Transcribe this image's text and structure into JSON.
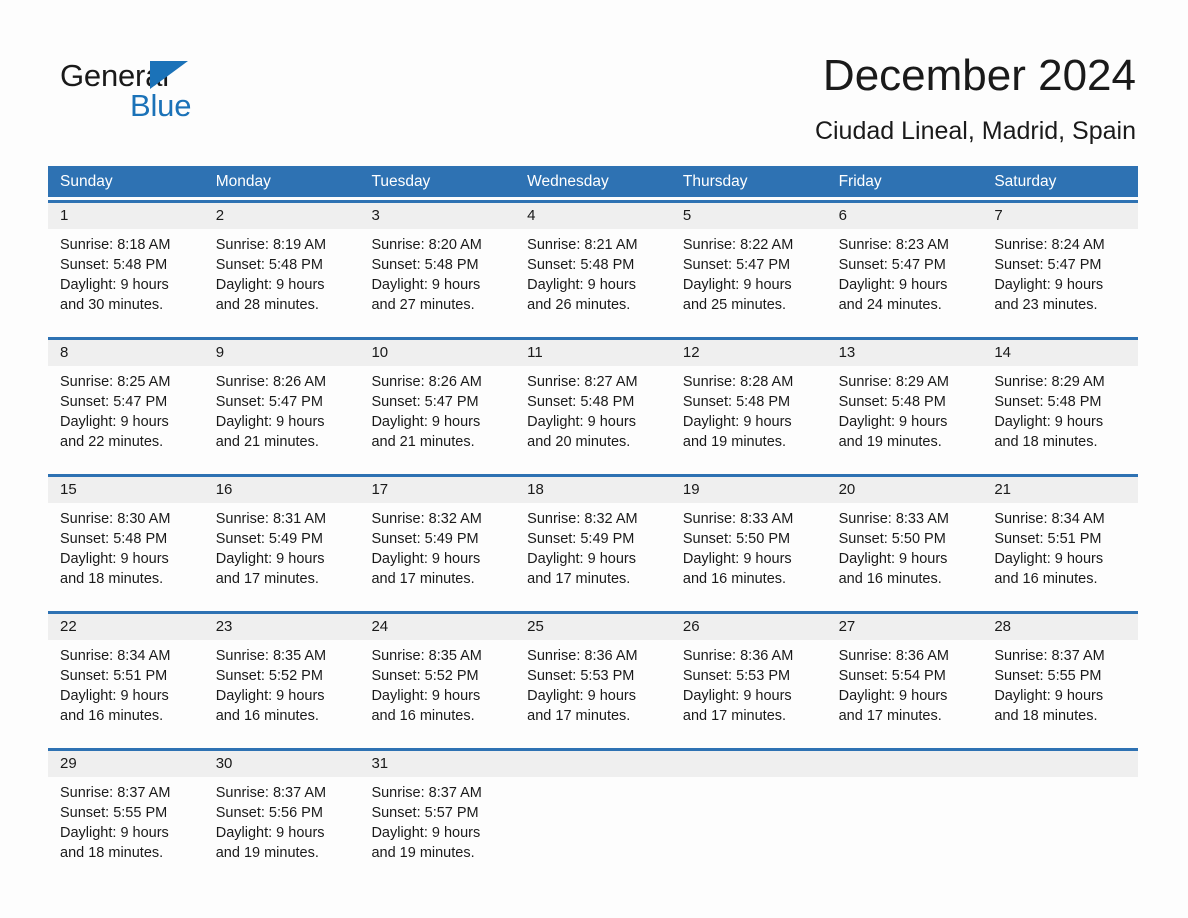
{
  "brand": {
    "name_part1": "General",
    "name_part2": "Blue",
    "accent_color": "#1b72b8"
  },
  "header": {
    "month_title": "December 2024",
    "location": "Ciudad Lineal, Madrid, Spain"
  },
  "calendar": {
    "header_color": "#2e72b3",
    "weekdays": [
      "Sunday",
      "Monday",
      "Tuesday",
      "Wednesday",
      "Thursday",
      "Friday",
      "Saturday"
    ],
    "weeks": [
      [
        {
          "date": "1",
          "sunrise": "Sunrise: 8:18 AM",
          "sunset": "Sunset: 5:48 PM",
          "daylight_line1": "Daylight: 9 hours",
          "daylight_line2": "and 30 minutes."
        },
        {
          "date": "2",
          "sunrise": "Sunrise: 8:19 AM",
          "sunset": "Sunset: 5:48 PM",
          "daylight_line1": "Daylight: 9 hours",
          "daylight_line2": "and 28 minutes."
        },
        {
          "date": "3",
          "sunrise": "Sunrise: 8:20 AM",
          "sunset": "Sunset: 5:48 PM",
          "daylight_line1": "Daylight: 9 hours",
          "daylight_line2": "and 27 minutes."
        },
        {
          "date": "4",
          "sunrise": "Sunrise: 8:21 AM",
          "sunset": "Sunset: 5:48 PM",
          "daylight_line1": "Daylight: 9 hours",
          "daylight_line2": "and 26 minutes."
        },
        {
          "date": "5",
          "sunrise": "Sunrise: 8:22 AM",
          "sunset": "Sunset: 5:47 PM",
          "daylight_line1": "Daylight: 9 hours",
          "daylight_line2": "and 25 minutes."
        },
        {
          "date": "6",
          "sunrise": "Sunrise: 8:23 AM",
          "sunset": "Sunset: 5:47 PM",
          "daylight_line1": "Daylight: 9 hours",
          "daylight_line2": "and 24 minutes."
        },
        {
          "date": "7",
          "sunrise": "Sunrise: 8:24 AM",
          "sunset": "Sunset: 5:47 PM",
          "daylight_line1": "Daylight: 9 hours",
          "daylight_line2": "and 23 minutes."
        }
      ],
      [
        {
          "date": "8",
          "sunrise": "Sunrise: 8:25 AM",
          "sunset": "Sunset: 5:47 PM",
          "daylight_line1": "Daylight: 9 hours",
          "daylight_line2": "and 22 minutes."
        },
        {
          "date": "9",
          "sunrise": "Sunrise: 8:26 AM",
          "sunset": "Sunset: 5:47 PM",
          "daylight_line1": "Daylight: 9 hours",
          "daylight_line2": "and 21 minutes."
        },
        {
          "date": "10",
          "sunrise": "Sunrise: 8:26 AM",
          "sunset": "Sunset: 5:47 PM",
          "daylight_line1": "Daylight: 9 hours",
          "daylight_line2": "and 21 minutes."
        },
        {
          "date": "11",
          "sunrise": "Sunrise: 8:27 AM",
          "sunset": "Sunset: 5:48 PM",
          "daylight_line1": "Daylight: 9 hours",
          "daylight_line2": "and 20 minutes."
        },
        {
          "date": "12",
          "sunrise": "Sunrise: 8:28 AM",
          "sunset": "Sunset: 5:48 PM",
          "daylight_line1": "Daylight: 9 hours",
          "daylight_line2": "and 19 minutes."
        },
        {
          "date": "13",
          "sunrise": "Sunrise: 8:29 AM",
          "sunset": "Sunset: 5:48 PM",
          "daylight_line1": "Daylight: 9 hours",
          "daylight_line2": "and 19 minutes."
        },
        {
          "date": "14",
          "sunrise": "Sunrise: 8:29 AM",
          "sunset": "Sunset: 5:48 PM",
          "daylight_line1": "Daylight: 9 hours",
          "daylight_line2": "and 18 minutes."
        }
      ],
      [
        {
          "date": "15",
          "sunrise": "Sunrise: 8:30 AM",
          "sunset": "Sunset: 5:48 PM",
          "daylight_line1": "Daylight: 9 hours",
          "daylight_line2": "and 18 minutes."
        },
        {
          "date": "16",
          "sunrise": "Sunrise: 8:31 AM",
          "sunset": "Sunset: 5:49 PM",
          "daylight_line1": "Daylight: 9 hours",
          "daylight_line2": "and 17 minutes."
        },
        {
          "date": "17",
          "sunrise": "Sunrise: 8:32 AM",
          "sunset": "Sunset: 5:49 PM",
          "daylight_line1": "Daylight: 9 hours",
          "daylight_line2": "and 17 minutes."
        },
        {
          "date": "18",
          "sunrise": "Sunrise: 8:32 AM",
          "sunset": "Sunset: 5:49 PM",
          "daylight_line1": "Daylight: 9 hours",
          "daylight_line2": "and 17 minutes."
        },
        {
          "date": "19",
          "sunrise": "Sunrise: 8:33 AM",
          "sunset": "Sunset: 5:50 PM",
          "daylight_line1": "Daylight: 9 hours",
          "daylight_line2": "and 16 minutes."
        },
        {
          "date": "20",
          "sunrise": "Sunrise: 8:33 AM",
          "sunset": "Sunset: 5:50 PM",
          "daylight_line1": "Daylight: 9 hours",
          "daylight_line2": "and 16 minutes."
        },
        {
          "date": "21",
          "sunrise": "Sunrise: 8:34 AM",
          "sunset": "Sunset: 5:51 PM",
          "daylight_line1": "Daylight: 9 hours",
          "daylight_line2": "and 16 minutes."
        }
      ],
      [
        {
          "date": "22",
          "sunrise": "Sunrise: 8:34 AM",
          "sunset": "Sunset: 5:51 PM",
          "daylight_line1": "Daylight: 9 hours",
          "daylight_line2": "and 16 minutes."
        },
        {
          "date": "23",
          "sunrise": "Sunrise: 8:35 AM",
          "sunset": "Sunset: 5:52 PM",
          "daylight_line1": "Daylight: 9 hours",
          "daylight_line2": "and 16 minutes."
        },
        {
          "date": "24",
          "sunrise": "Sunrise: 8:35 AM",
          "sunset": "Sunset: 5:52 PM",
          "daylight_line1": "Daylight: 9 hours",
          "daylight_line2": "and 16 minutes."
        },
        {
          "date": "25",
          "sunrise": "Sunrise: 8:36 AM",
          "sunset": "Sunset: 5:53 PM",
          "daylight_line1": "Daylight: 9 hours",
          "daylight_line2": "and 17 minutes."
        },
        {
          "date": "26",
          "sunrise": "Sunrise: 8:36 AM",
          "sunset": "Sunset: 5:53 PM",
          "daylight_line1": "Daylight: 9 hours",
          "daylight_line2": "and 17 minutes."
        },
        {
          "date": "27",
          "sunrise": "Sunrise: 8:36 AM",
          "sunset": "Sunset: 5:54 PM",
          "daylight_line1": "Daylight: 9 hours",
          "daylight_line2": "and 17 minutes."
        },
        {
          "date": "28",
          "sunrise": "Sunrise: 8:37 AM",
          "sunset": "Sunset: 5:55 PM",
          "daylight_line1": "Daylight: 9 hours",
          "daylight_line2": "and 18 minutes."
        }
      ],
      [
        {
          "date": "29",
          "sunrise": "Sunrise: 8:37 AM",
          "sunset": "Sunset: 5:55 PM",
          "daylight_line1": "Daylight: 9 hours",
          "daylight_line2": "and 18 minutes."
        },
        {
          "date": "30",
          "sunrise": "Sunrise: 8:37 AM",
          "sunset": "Sunset: 5:56 PM",
          "daylight_line1": "Daylight: 9 hours",
          "daylight_line2": "and 19 minutes."
        },
        {
          "date": "31",
          "sunrise": "Sunrise: 8:37 AM",
          "sunset": "Sunset: 5:57 PM",
          "daylight_line1": "Daylight: 9 hours",
          "daylight_line2": "and 19 minutes."
        },
        {
          "date": "",
          "sunrise": "",
          "sunset": "",
          "daylight_line1": "",
          "daylight_line2": ""
        },
        {
          "date": "",
          "sunrise": "",
          "sunset": "",
          "daylight_line1": "",
          "daylight_line2": ""
        },
        {
          "date": "",
          "sunrise": "",
          "sunset": "",
          "daylight_line1": "",
          "daylight_line2": ""
        },
        {
          "date": "",
          "sunrise": "",
          "sunset": "",
          "daylight_line1": "",
          "daylight_line2": ""
        }
      ]
    ]
  }
}
